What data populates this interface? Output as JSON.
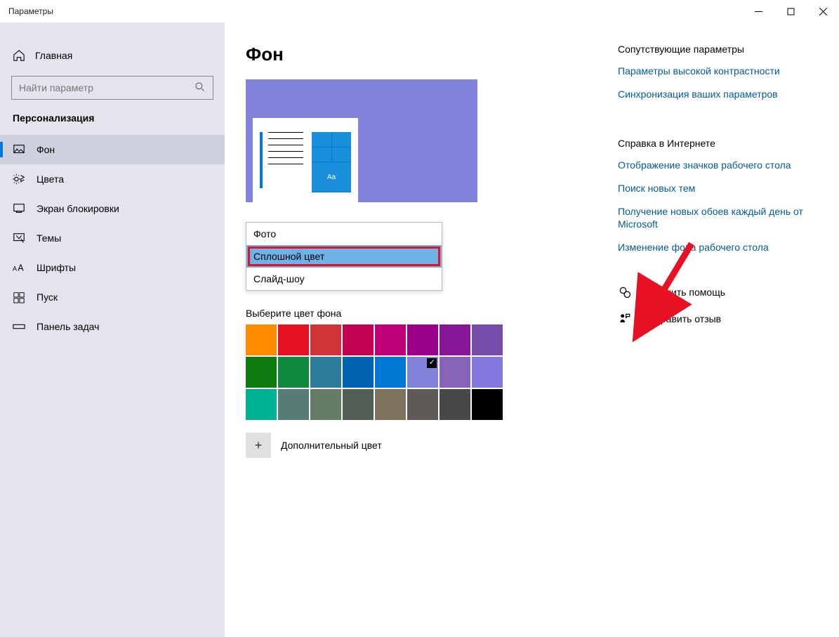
{
  "window": {
    "title": "Параметры"
  },
  "sidebar": {
    "home": "Главная",
    "search_placeholder": "Найти параметр",
    "section": "Персонализация",
    "items": [
      {
        "label": "Фон",
        "active": true
      },
      {
        "label": "Цвета",
        "active": false
      },
      {
        "label": "Экран блокировки",
        "active": false
      },
      {
        "label": "Темы",
        "active": false
      },
      {
        "label": "Шрифты",
        "active": false
      },
      {
        "label": "Пуск",
        "active": false
      },
      {
        "label": "Панель задач",
        "active": false
      }
    ]
  },
  "page": {
    "title": "Фон",
    "preview_sample_label": "Aa",
    "dropdown": {
      "options": [
        {
          "label": "Фото",
          "selected": false
        },
        {
          "label": "Сплошной цвет",
          "selected": true
        },
        {
          "label": "Слайд-шоу",
          "selected": false
        }
      ]
    },
    "pick_label": "Выберите цвет фона",
    "colors": [
      "#ff8c00",
      "#e81123",
      "#d13438",
      "#c30052",
      "#bf0077",
      "#9a0089",
      "#881798",
      "#744da9",
      "#107c10",
      "#10893e",
      "#2d7d9a",
      "#0063b1",
      "#0078d4",
      "#8283da",
      "#8764b8",
      "#8378de",
      "#00b294",
      "#567c73",
      "#647c64",
      "#525e54",
      "#7e735f",
      "#5d5a58",
      "#4a4846",
      "#000000"
    ],
    "selected_color_index": 13,
    "custom_color_label": "Дополнительный цвет"
  },
  "right": {
    "related_heading": "Сопутствующие параметры",
    "related_links": [
      "Параметры высокой контрастности",
      "Синхронизация ваших параметров"
    ],
    "help_heading": "Справка в Интернете",
    "help_links": [
      "Отображение значков рабочего стола",
      "Поиск новых тем",
      "Получение новых обоев каждый день от Microsoft",
      "Изменение фона рабочего стола"
    ],
    "get_help": "Получить помощь",
    "feedback": "Отправить отзыв"
  }
}
